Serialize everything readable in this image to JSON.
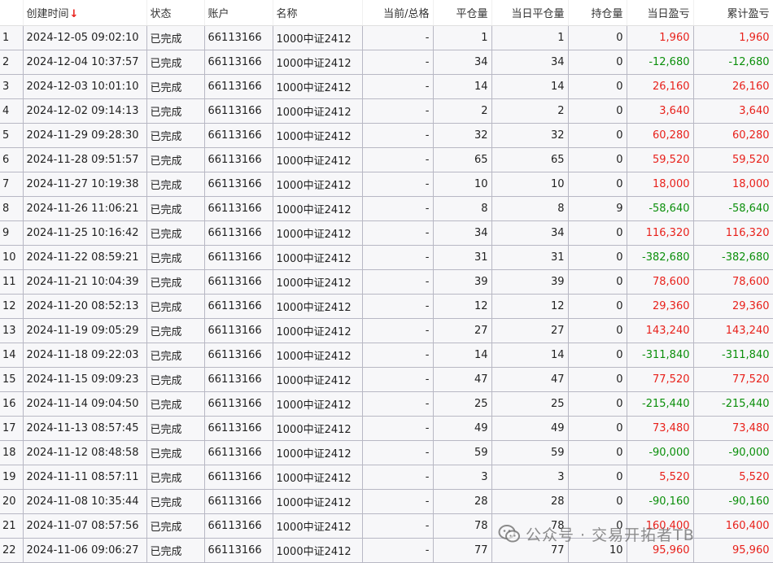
{
  "table": {
    "columns": {
      "index": "",
      "created": "创建时间",
      "status": "状态",
      "account": "账户",
      "name": "名称",
      "current_total": "当前/总格",
      "close_qty": "平仓量",
      "today_close": "当日平仓量",
      "holding": "持仓量",
      "daily_pnl": "当日盈亏",
      "cum_pnl": "累计盈亏"
    },
    "sort_indicator": "↓",
    "rows": [
      {
        "idx": "1",
        "created": "2024-12-05 09:02:10",
        "status": "已完成",
        "account": "66113166",
        "name": "1000中证2412",
        "ct": "-",
        "close": "1",
        "today": "1",
        "hold": "0",
        "daily": "1,960",
        "cum": "1,960",
        "sign": "pos"
      },
      {
        "idx": "2",
        "created": "2024-12-04 10:37:57",
        "status": "已完成",
        "account": "66113166",
        "name": "1000中证2412",
        "ct": "-",
        "close": "34",
        "today": "34",
        "hold": "0",
        "daily": "-12,680",
        "cum": "-12,680",
        "sign": "neg"
      },
      {
        "idx": "3",
        "created": "2024-12-03 10:01:10",
        "status": "已完成",
        "account": "66113166",
        "name": "1000中证2412",
        "ct": "-",
        "close": "14",
        "today": "14",
        "hold": "0",
        "daily": "26,160",
        "cum": "26,160",
        "sign": "pos"
      },
      {
        "idx": "4",
        "created": "2024-12-02 09:14:13",
        "status": "已完成",
        "account": "66113166",
        "name": "1000中证2412",
        "ct": "-",
        "close": "2",
        "today": "2",
        "hold": "0",
        "daily": "3,640",
        "cum": "3,640",
        "sign": "pos"
      },
      {
        "idx": "5",
        "created": "2024-11-29 09:28:30",
        "status": "已完成",
        "account": "66113166",
        "name": "1000中证2412",
        "ct": "-",
        "close": "32",
        "today": "32",
        "hold": "0",
        "daily": "60,280",
        "cum": "60,280",
        "sign": "pos"
      },
      {
        "idx": "6",
        "created": "2024-11-28 09:51:57",
        "status": "已完成",
        "account": "66113166",
        "name": "1000中证2412",
        "ct": "-",
        "close": "65",
        "today": "65",
        "hold": "0",
        "daily": "59,520",
        "cum": "59,520",
        "sign": "pos"
      },
      {
        "idx": "7",
        "created": "2024-11-27 10:19:38",
        "status": "已完成",
        "account": "66113166",
        "name": "1000中证2412",
        "ct": "-",
        "close": "10",
        "today": "10",
        "hold": "0",
        "daily": "18,000",
        "cum": "18,000",
        "sign": "pos"
      },
      {
        "idx": "8",
        "created": "2024-11-26 11:06:21",
        "status": "已完成",
        "account": "66113166",
        "name": "1000中证2412",
        "ct": "-",
        "close": "8",
        "today": "8",
        "hold": "9",
        "daily": "-58,640",
        "cum": "-58,640",
        "sign": "neg"
      },
      {
        "idx": "9",
        "created": "2024-11-25 10:16:42",
        "status": "已完成",
        "account": "66113166",
        "name": "1000中证2412",
        "ct": "-",
        "close": "34",
        "today": "34",
        "hold": "0",
        "daily": "116,320",
        "cum": "116,320",
        "sign": "pos"
      },
      {
        "idx": "10",
        "created": "2024-11-22 08:59:21",
        "status": "已完成",
        "account": "66113166",
        "name": "1000中证2412",
        "ct": "-",
        "close": "31",
        "today": "31",
        "hold": "0",
        "daily": "-382,680",
        "cum": "-382,680",
        "sign": "neg"
      },
      {
        "idx": "11",
        "created": "2024-11-21 10:04:39",
        "status": "已完成",
        "account": "66113166",
        "name": "1000中证2412",
        "ct": "-",
        "close": "39",
        "today": "39",
        "hold": "0",
        "daily": "78,600",
        "cum": "78,600",
        "sign": "pos"
      },
      {
        "idx": "12",
        "created": "2024-11-20 08:52:13",
        "status": "已完成",
        "account": "66113166",
        "name": "1000中证2412",
        "ct": "-",
        "close": "12",
        "today": "12",
        "hold": "0",
        "daily": "29,360",
        "cum": "29,360",
        "sign": "pos"
      },
      {
        "idx": "13",
        "created": "2024-11-19 09:05:29",
        "status": "已完成",
        "account": "66113166",
        "name": "1000中证2412",
        "ct": "-",
        "close": "27",
        "today": "27",
        "hold": "0",
        "daily": "143,240",
        "cum": "143,240",
        "sign": "pos"
      },
      {
        "idx": "14",
        "created": "2024-11-18 09:22:03",
        "status": "已完成",
        "account": "66113166",
        "name": "1000中证2412",
        "ct": "-",
        "close": "14",
        "today": "14",
        "hold": "0",
        "daily": "-311,840",
        "cum": "-311,840",
        "sign": "neg"
      },
      {
        "idx": "15",
        "created": "2024-11-15 09:09:23",
        "status": "已完成",
        "account": "66113166",
        "name": "1000中证2412",
        "ct": "-",
        "close": "47",
        "today": "47",
        "hold": "0",
        "daily": "77,520",
        "cum": "77,520",
        "sign": "pos"
      },
      {
        "idx": "16",
        "created": "2024-11-14 09:04:50",
        "status": "已完成",
        "account": "66113166",
        "name": "1000中证2412",
        "ct": "-",
        "close": "25",
        "today": "25",
        "hold": "0",
        "daily": "-215,440",
        "cum": "-215,440",
        "sign": "neg"
      },
      {
        "idx": "17",
        "created": "2024-11-13 08:57:45",
        "status": "已完成",
        "account": "66113166",
        "name": "1000中证2412",
        "ct": "-",
        "close": "49",
        "today": "49",
        "hold": "0",
        "daily": "73,480",
        "cum": "73,480",
        "sign": "pos"
      },
      {
        "idx": "18",
        "created": "2024-11-12 08:48:58",
        "status": "已完成",
        "account": "66113166",
        "name": "1000中证2412",
        "ct": "-",
        "close": "59",
        "today": "59",
        "hold": "0",
        "daily": "-90,000",
        "cum": "-90,000",
        "sign": "neg"
      },
      {
        "idx": "19",
        "created": "2024-11-11 08:57:11",
        "status": "已完成",
        "account": "66113166",
        "name": "1000中证2412",
        "ct": "-",
        "close": "3",
        "today": "3",
        "hold": "0",
        "daily": "5,520",
        "cum": "5,520",
        "sign": "pos"
      },
      {
        "idx": "20",
        "created": "2024-11-08 10:35:44",
        "status": "已完成",
        "account": "66113166",
        "name": "1000中证2412",
        "ct": "-",
        "close": "28",
        "today": "28",
        "hold": "0",
        "daily": "-90,160",
        "cum": "-90,160",
        "sign": "neg"
      },
      {
        "idx": "21",
        "created": "2024-11-07 08:57:56",
        "status": "已完成",
        "account": "66113166",
        "name": "1000中证2412",
        "ct": "-",
        "close": "78",
        "today": "78",
        "hold": "0",
        "daily": "160,400",
        "cum": "160,400",
        "sign": "pos"
      },
      {
        "idx": "22",
        "created": "2024-11-06 09:06:27",
        "status": "已完成",
        "account": "66113166",
        "name": "1000中证2412",
        "ct": "-",
        "close": "77",
        "today": "77",
        "hold": "10",
        "daily": "95,960",
        "cum": "95,960",
        "sign": "pos"
      }
    ]
  },
  "watermark": {
    "text": "公众号 · 交易开拓者TB",
    "icon": "wechat-icon"
  },
  "colors": {
    "profit": "#e8211b",
    "loss": "#0b8f0b",
    "sort_arrow": "#e8211b"
  }
}
